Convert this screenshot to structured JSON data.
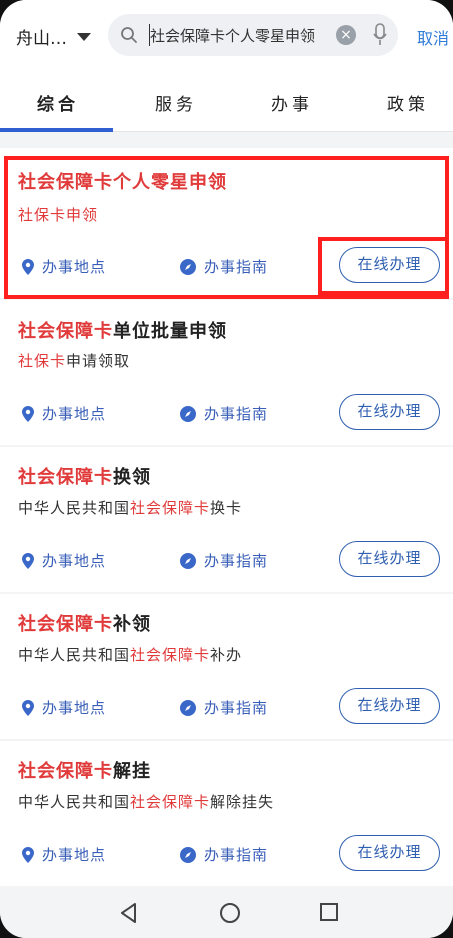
{
  "header": {
    "city": "舟山…",
    "search_query": "社会保障卡个人零星申领",
    "cancel_label": "取消"
  },
  "tabs": [
    {
      "label": "综合",
      "active": true
    },
    {
      "label": "服务",
      "active": false
    },
    {
      "label": "办事",
      "active": false
    },
    {
      "label": "政策",
      "active": false
    }
  ],
  "results": [
    {
      "title_hl": "社会保障卡个人零星申领",
      "title_rest": "",
      "sub_pre": "",
      "sub_hl": "社保卡申领",
      "sub_rest": "",
      "location_label": "办事地点",
      "guide_label": "办事指南",
      "online_label": "在线办理"
    },
    {
      "title_hl": "社会保障卡",
      "title_rest": "单位批量申领",
      "sub_pre": "",
      "sub_hl": "社保卡",
      "sub_rest": "申请领取",
      "location_label": "办事地点",
      "guide_label": "办事指南",
      "online_label": "在线办理"
    },
    {
      "title_hl": "社会保障卡",
      "title_rest": "换领",
      "sub_pre": "中华人民共和国",
      "sub_hl": "社会保障卡",
      "sub_rest": "换卡",
      "location_label": "办事地点",
      "guide_label": "办事指南",
      "online_label": "在线办理"
    },
    {
      "title_hl": "社会保障卡",
      "title_rest": "补领",
      "sub_pre": "中华人民共和国",
      "sub_hl": "社会保障卡",
      "sub_rest": "补办",
      "location_label": "办事地点",
      "guide_label": "办事指南",
      "online_label": "在线办理"
    },
    {
      "title_hl": "社会保障卡",
      "title_rest": "解挂",
      "sub_pre": "中华人民共和国",
      "sub_hl": "社会保障卡",
      "sub_rest": "解除挂失",
      "location_label": "办事地点",
      "guide_label": "办事指南",
      "online_label": "在线办理"
    }
  ],
  "colors": {
    "highlight": "#e03a3a",
    "accent": "#2f5fb0",
    "annotation": "#ff1f1f"
  }
}
